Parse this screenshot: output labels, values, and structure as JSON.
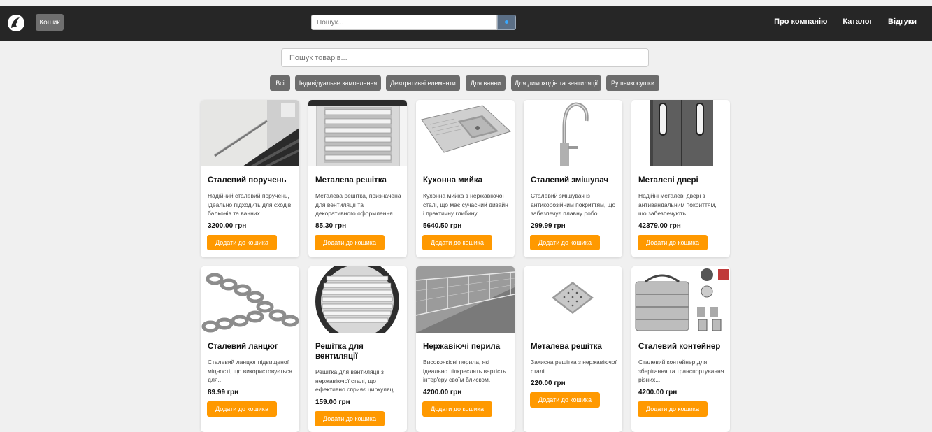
{
  "navbar": {
    "cart_label": "Кошик",
    "search_placeholder": "Пошук...",
    "links": [
      "Про компанію",
      "Каталог",
      "Відгуки"
    ]
  },
  "product_search": {
    "placeholder": "Пошук товарів..."
  },
  "filters": [
    "Всі",
    "Індивідуальне замовлення",
    "Декоративні елементи",
    "Для ванни",
    "Для димоходів та вентиляції",
    "Рушникосушки"
  ],
  "add_label": "Додати до кошика",
  "products": [
    {
      "title": "Сталевий поручень",
      "desc": "Надійний сталевий поручень, ідеально підходить для сходів, балконів та ванних...",
      "price": "3200.00 грн",
      "image": "stairs-handrail"
    },
    {
      "title": "Металева решітка",
      "desc": "Металева решітка, призначена для вентиляції та декоративного оформлення...",
      "price": "85.30 грн",
      "image": "vent-grille"
    },
    {
      "title": "Кухонна мийка",
      "desc": "Кухонна мийка з нержавіючої сталі, що має сучасний дизайн і практичну глибину...",
      "price": "5640.50 грн",
      "image": "kitchen-sink"
    },
    {
      "title": "Сталевий змішувач",
      "desc": "Сталевий змішувач із антикорозійним покриттям, що забезпечує плавну робо...",
      "price": "299.99 грн",
      "image": "faucet"
    },
    {
      "title": "Металеві двері",
      "desc": "Надійні металеві двері з антивандальним покриттям, що забезпечують...",
      "price": "42379.00 грн",
      "image": "metal-doors"
    },
    {
      "title": "Сталевий ланцюг",
      "desc": "Сталевий ланцюг підвищеної міцності, що використовується для...",
      "price": "89.99 грн",
      "image": "chain"
    },
    {
      "title": "Решітка для вентиляції",
      "desc": "Решітка для вентиляції з нержавіючої сталі, що ефективно сприяє циркуляц...",
      "price": "159.00 грн",
      "image": "round-vent"
    },
    {
      "title": "Нержавіючі перила",
      "desc": "Високоякісні перила, які ідеально підкреслять вартість інтер'єру своїм блиском.",
      "price": "4200.00 грн",
      "image": "railing"
    },
    {
      "title": "Металева решітка",
      "desc": "Захисна решітка з нержавіючої сталі",
      "price": "220.00 грн",
      "image": "drain-grate"
    },
    {
      "title": "Сталевий контейнер",
      "desc": "Сталевий контейнер для зберігання та транспортування різних...",
      "price": "4200.00 грн",
      "image": "steel-container"
    }
  ]
}
